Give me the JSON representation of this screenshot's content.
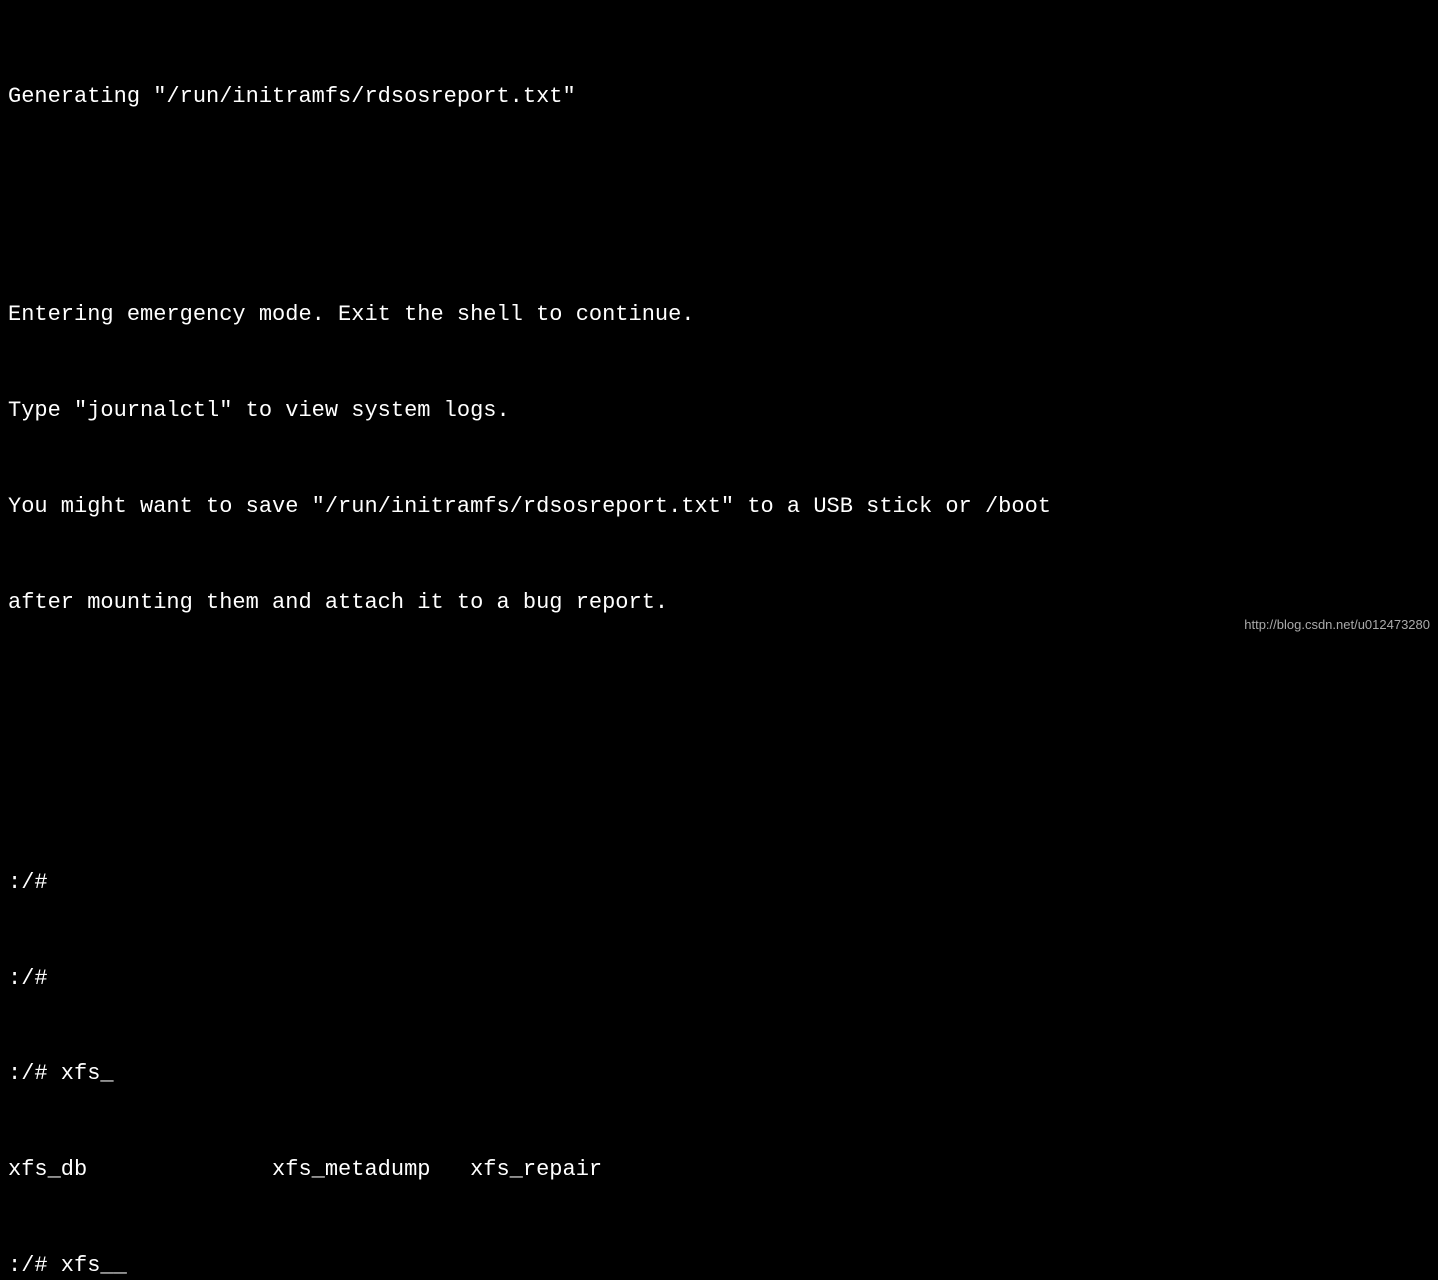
{
  "terminal": {
    "lines": [
      "Generating \"/run/initramfs/rdsosreport.txt\"",
      "",
      "",
      "Entering emergency mode. Exit the shell to continue.",
      "Type \"journalctl\" to view system logs.",
      "You might want to save \"/run/initramfs/rdsosreport.txt\" to a USB stick or /boot",
      "after mounting them and attach it to a bug report.",
      "",
      "",
      "",
      ":/# ",
      ":/# ",
      ":/# xfs_",
      "xfs_db              xfs_metadump   xfs_repair",
      ":/# xfs__"
    ]
  },
  "watermark": {
    "text": "http://blog.csdn.net/u012473280"
  }
}
